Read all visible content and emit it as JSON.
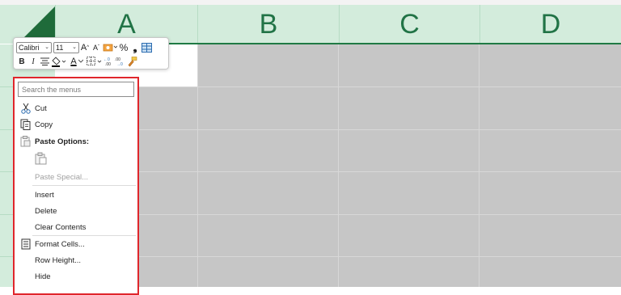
{
  "columns": [
    "A",
    "B",
    "C",
    "D"
  ],
  "mini_toolbar": {
    "font_name": "Calibri",
    "font_size": "11",
    "grow_label": "A",
    "shrink_label": "A",
    "percent_label": "%",
    "comma_label": "❟",
    "bold_label": "B",
    "italic_label": "I",
    "font_color_label": "A",
    "font_color": "#000000",
    "fill_color": "#000000"
  },
  "context_menu": {
    "search_placeholder": "Search the menus",
    "items": [
      {
        "label": "Cut",
        "icon": "scissors-icon",
        "enabled": true
      },
      {
        "label": "Copy",
        "icon": "copy-icon",
        "enabled": true
      },
      {
        "label": "Paste Options:",
        "icon": "clipboard-icon",
        "enabled": true,
        "bold": true
      },
      {
        "label": "Paste Special...",
        "enabled": false
      },
      {
        "label": "Insert",
        "enabled": true
      },
      {
        "label": "Delete",
        "enabled": true
      },
      {
        "label": "Clear Contents",
        "enabled": true
      },
      {
        "label": "Format Cells...",
        "icon": "format-cells-icon",
        "enabled": true
      },
      {
        "label": "Row Height...",
        "enabled": true
      },
      {
        "label": "Hide",
        "enabled": true
      }
    ]
  },
  "colors": {
    "header_bg": "#d3ecdc",
    "header_text": "#217346",
    "selection_gray": "#c6c6c6",
    "highlight_border": "#e0262c"
  }
}
